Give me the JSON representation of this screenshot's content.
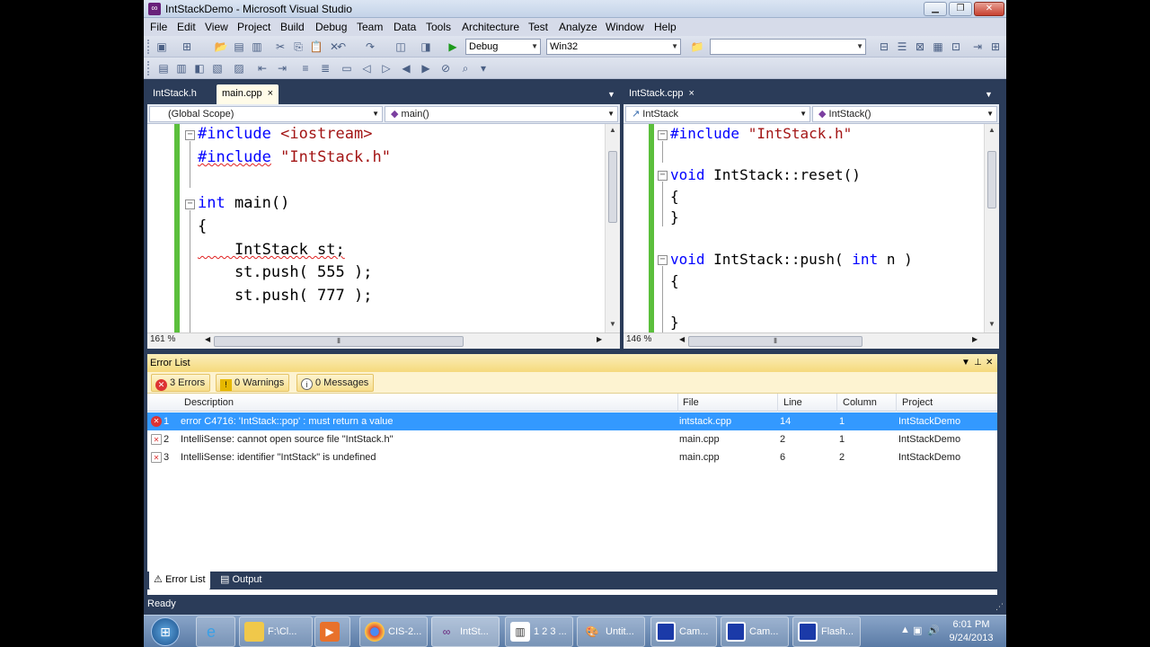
{
  "window": {
    "title": "IntStackDemo - Microsoft Visual Studio"
  },
  "menu": [
    "File",
    "Edit",
    "View",
    "Project",
    "Build",
    "Debug",
    "Team",
    "Data",
    "Tools",
    "Architecture",
    "Test",
    "Analyze",
    "Window",
    "Help"
  ],
  "toolbar": {
    "configuration": "Debug",
    "platform": "Win32",
    "search_value": ""
  },
  "left_editor": {
    "tabs": [
      {
        "label": "IntStack.h"
      },
      {
        "label": "main.cpp",
        "close": "×"
      }
    ],
    "scope": "(Global Scope)",
    "member": "main()",
    "zoom": "161 %",
    "lines": [
      {
        "kw": "#include",
        "rest": " <iostream>",
        "rest_class": "str"
      },
      {
        "kw": "#include",
        "rest": " \"IntStack.h\"",
        "rest_class": "str"
      },
      {
        "kw": "",
        "rest": ""
      },
      {
        "kw": "int",
        "rest": " main()"
      },
      {
        "kw": "",
        "rest": "{"
      },
      {
        "kw": "",
        "rest": "    IntStack st;"
      },
      {
        "kw": "",
        "rest": "    st.push( 555 );"
      },
      {
        "kw": "",
        "rest": "    st.push( 777 );"
      }
    ]
  },
  "right_editor": {
    "tabs": [
      {
        "label": "IntStack.cpp",
        "close": "×"
      }
    ],
    "scope": "IntStack",
    "member": "IntStack()",
    "zoom": "146 %",
    "lines": [
      {
        "kw": "#include",
        "rest": " \"IntStack.h\""
      },
      {
        "kw": "",
        "rest": ""
      },
      {
        "kw": "void",
        "rest": " IntStack::reset()"
      },
      {
        "kw": "",
        "rest": "{"
      },
      {
        "kw": "",
        "rest": "}"
      },
      {
        "kw": "",
        "rest": ""
      },
      {
        "kw": "void",
        "rest": " IntStack::push( ",
        "kw2": "int",
        "rest2": " n )"
      },
      {
        "kw": "",
        "rest": "{"
      },
      {
        "kw": "",
        "rest": ""
      },
      {
        "kw": "",
        "rest": "}"
      }
    ]
  },
  "error_list": {
    "title": "Error List",
    "filters": {
      "errors": "3 Errors",
      "warnings": "0 Warnings",
      "messages": "0 Messages"
    },
    "columns": {
      "description": "Description",
      "file": "File",
      "line": "Line",
      "column": "Column",
      "project": "Project"
    },
    "rows": [
      {
        "num": "1",
        "description": "error C4716: 'IntStack::pop' : must return a value",
        "file": "intstack.cpp",
        "line": "14",
        "column": "1",
        "project": "IntStackDemo"
      },
      {
        "num": "2",
        "description": "IntelliSense: cannot open source file \"IntStack.h\"",
        "file": "main.cpp",
        "line": "2",
        "column": "1",
        "project": "IntStackDemo"
      },
      {
        "num": "3",
        "description": "IntelliSense: identifier \"IntStack\" is undefined",
        "file": "main.cpp",
        "line": "6",
        "column": "2",
        "project": "IntStackDemo"
      }
    ],
    "bottom_tabs": [
      "Error List",
      "Output"
    ]
  },
  "status": {
    "text": "Ready"
  },
  "taskbar": {
    "items": [
      "",
      "F:\\Cl...",
      "",
      "CIS-2...",
      "IntSt...",
      "1 2 3 ...",
      "Untit...",
      "Cam...",
      "Cam...",
      "Flash..."
    ],
    "time": "6:01 PM",
    "date": "9/24/2013"
  }
}
